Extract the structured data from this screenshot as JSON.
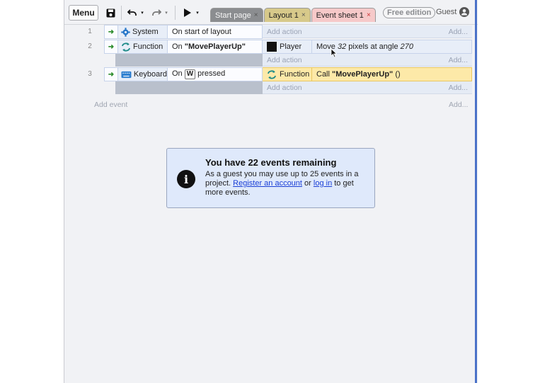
{
  "toolbar": {
    "menu_label": "Menu",
    "tabs": [
      {
        "label": "Start page"
      },
      {
        "label": "Layout 1"
      },
      {
        "label": "Event sheet 1"
      }
    ],
    "tab_close": "×",
    "edition_badge": "Free edition",
    "user_label": "Guest"
  },
  "events": [
    {
      "number": "1",
      "condition": {
        "object": "System",
        "text": "On start of layout"
      },
      "add_action": "Add action",
      "add": "Add..."
    },
    {
      "number": "2",
      "condition": {
        "object": "Function",
        "text_prefix": "On ",
        "text_bold": "\"MovePlayerUp\""
      },
      "action": {
        "object": "Player",
        "text_1": "Move ",
        "text_num": "32",
        "text_2": " pixels at angle ",
        "text_angle": "270"
      },
      "add_action": "Add action",
      "add": "Add..."
    },
    {
      "number": "3",
      "condition": {
        "object": "Keyboard",
        "text_prefix": "On",
        "key": "W",
        "text_suffix": "pressed"
      },
      "action": {
        "object": "Function",
        "text_prefix": "Call ",
        "text_bold": "\"MovePlayerUp\"",
        "text_suffix": " ()"
      },
      "add_action": "Add action",
      "add": "Add..."
    }
  ],
  "add_event": "Add event",
  "add_event_right": "Add...",
  "info": {
    "title": "You have 22 events remaining",
    "body_1": "As a guest you may use up to 25 events in a project. ",
    "link_register": "Register an account",
    "body_2": " or ",
    "link_login": "log in",
    "body_3": " to get more events."
  },
  "colors": {
    "highlight_action": "#fde9a8",
    "info_bg": "#dfe9fb",
    "link": "#1a3fd6"
  }
}
